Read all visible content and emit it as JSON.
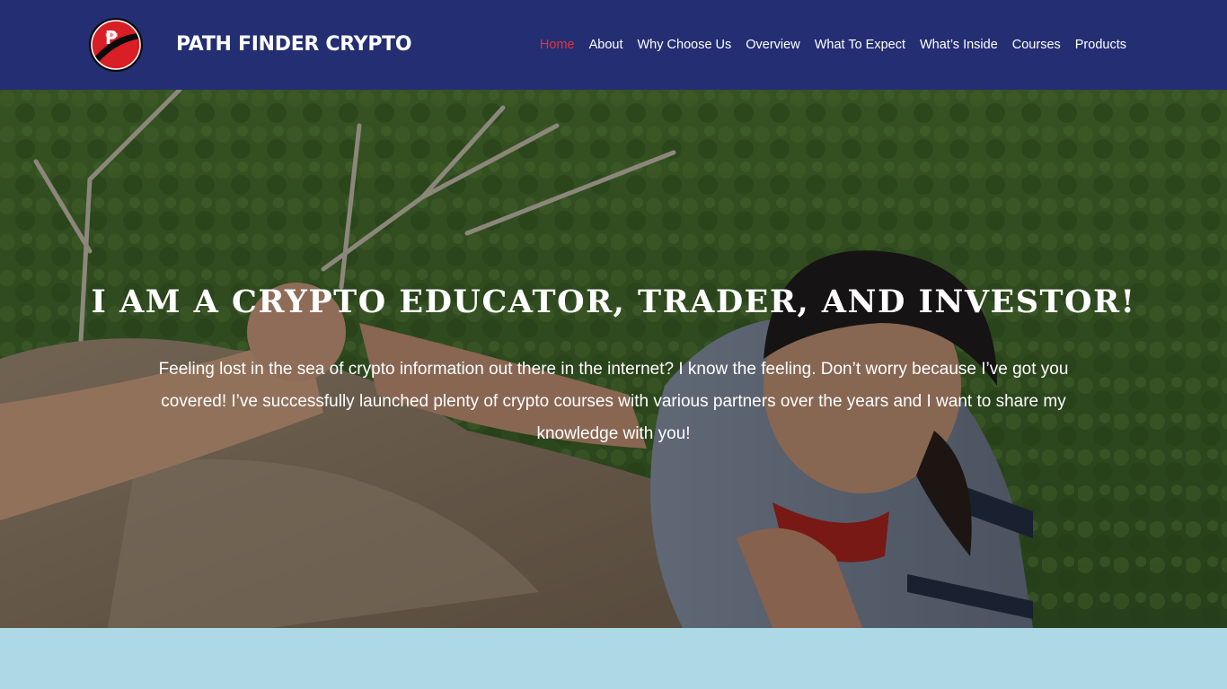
{
  "header": {
    "brand": "PATH FINDER CRYPTO",
    "logo_icon": "path-finder-crypto-logo",
    "nav": [
      {
        "label": "Home",
        "active": true
      },
      {
        "label": "About"
      },
      {
        "label": "Why Choose Us"
      },
      {
        "label": "Overview"
      },
      {
        "label": "What To Expect"
      },
      {
        "label": "What’s Inside"
      },
      {
        "label": "Courses"
      },
      {
        "label": "Products"
      }
    ]
  },
  "hero": {
    "title": "I AM A CRYPTO EDUCATOR, TRADER, AND INVESTOR!",
    "text": "Feeling lost in the sea of crypto information out there in the internet? I know the feeling. Don’t worry because I’ve got you covered! I’ve successfully launched plenty of crypto courses with various partners over the years and I want to share my knowledge with you!"
  },
  "colors": {
    "header_bg": "#232e73",
    "nav_active": "#e8303a",
    "band_bg": "#add8e6"
  }
}
